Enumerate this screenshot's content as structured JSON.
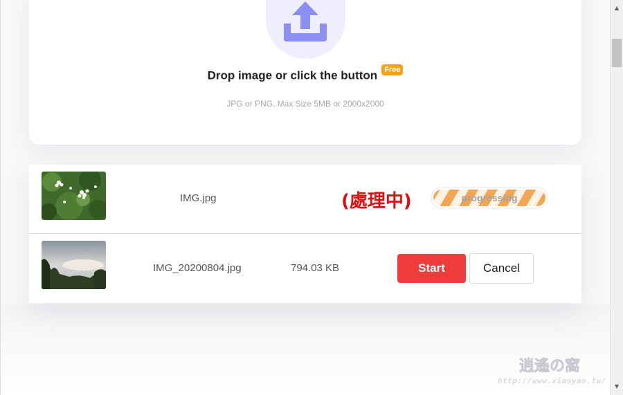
{
  "upload": {
    "icon": "upload-tray-icon",
    "title": "Drop image or click the button",
    "badge": "Free",
    "hint": "JPG or PNG. Max Size 5MB or 2000x2000",
    "accent_color": "#8b8ff0"
  },
  "files": [
    {
      "thumbnail": "white flowers with green leaves",
      "name": "IMG.jpg",
      "processing_note": "(處理中)",
      "progress_label": "progressing",
      "progress": 1.0,
      "progress_color": "#f2a654"
    },
    {
      "thumbnail": "sky over trees",
      "name": "IMG_20200804.jpg",
      "size": "794.03 KB",
      "start_label": "Start",
      "cancel_label": "Cancel",
      "start_color": "#ee3b3b"
    }
  ],
  "watermark": {
    "text": "逍遙の窩",
    "url": "http://www.xiaoyao.tw/"
  }
}
